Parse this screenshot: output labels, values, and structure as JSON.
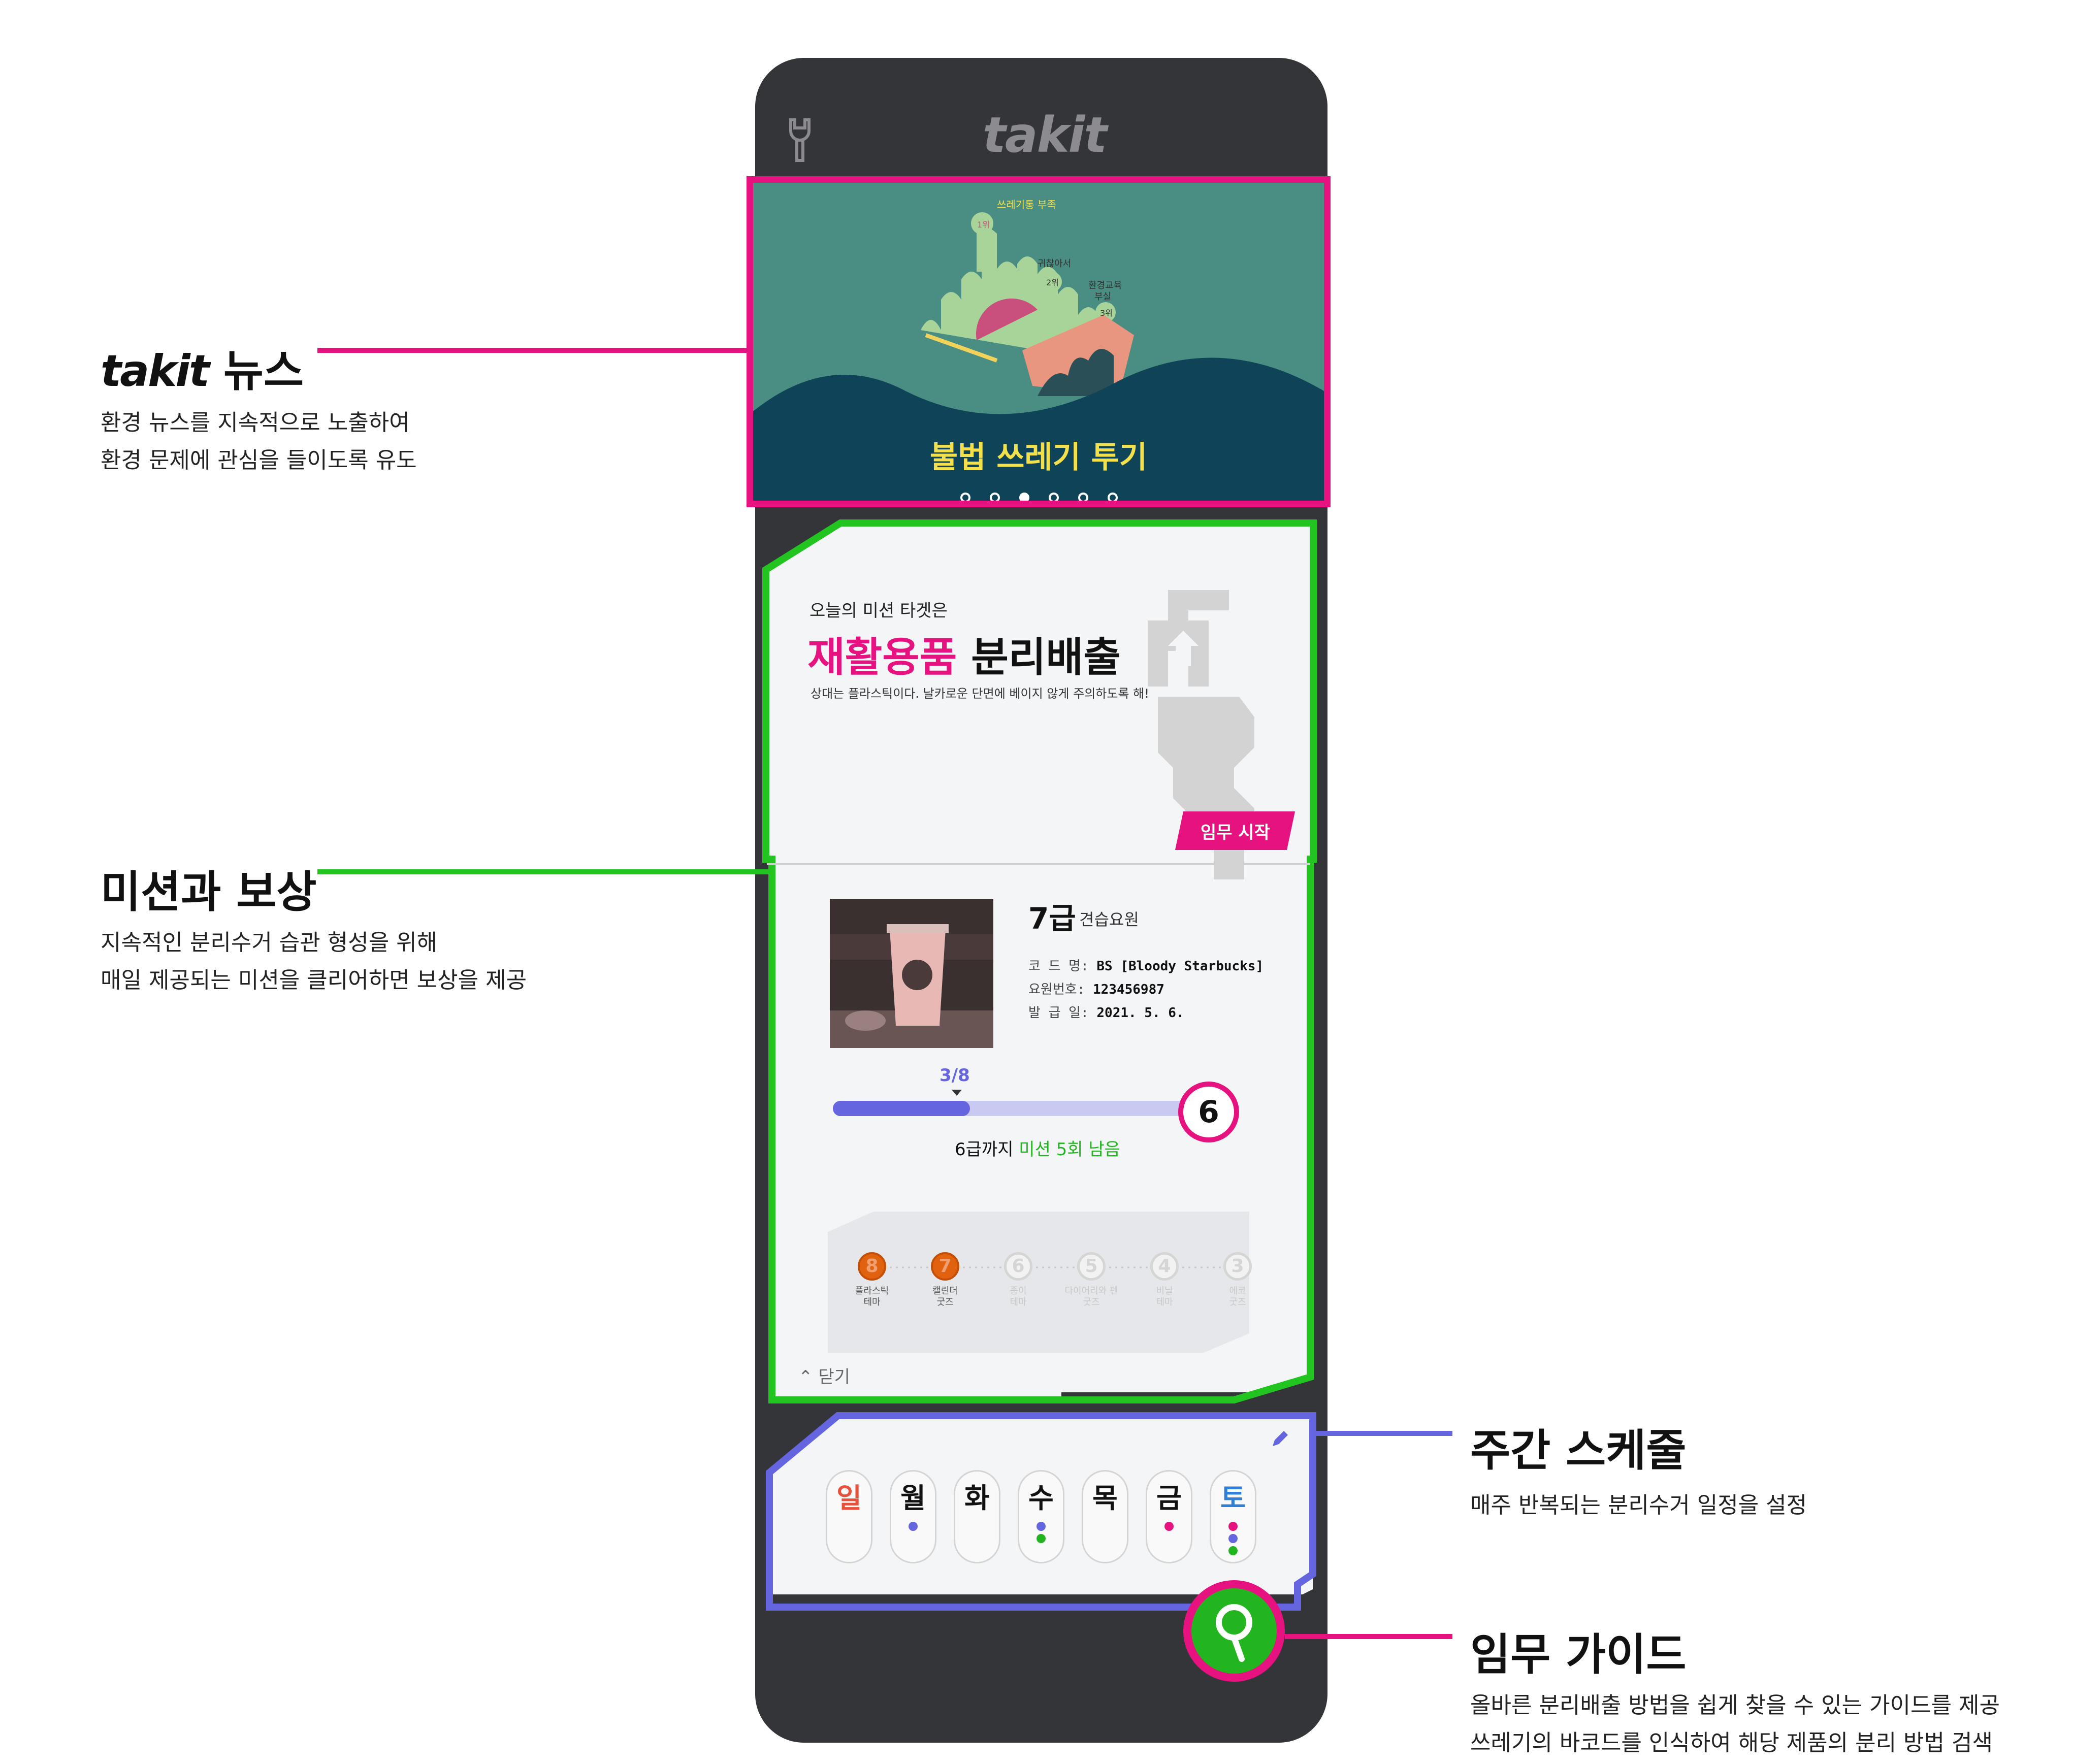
{
  "app": {
    "logo": "takit"
  },
  "news": {
    "infographic_labels": [
      "쓰레기통 부족",
      "1위",
      "귀찮아서",
      "2위",
      "환경교육",
      "부실",
      "3위"
    ],
    "title": "불법 쓰레기 투기",
    "slides": 6,
    "active_slide": 3
  },
  "mission": {
    "intro": "오늘의 미션 타겟은",
    "title_highlight": "재활용품",
    "title_rest": "분리배출",
    "description": "상대는 플라스틱이다. 날카로운 단면에 베이지 않게 주의하도록 해!",
    "start_button": "임무 시작"
  },
  "profile": {
    "grade": "7급",
    "rank": "견습요원",
    "code_label": "코 드 명:",
    "code_value": "BS [Bloody Starbucks]",
    "id_label": "요원번호:",
    "id_value": "123456987",
    "date_label": "발 급 일:",
    "date_value": "2021. 5. 6.",
    "progress_text": "3/8",
    "progress_fraction": 0.375,
    "next_grade": "6",
    "remain_prefix": "6급까지",
    "remain_highlight": "미션 5회 남음"
  },
  "steps": [
    {
      "num": "8",
      "label1": "플라스틱",
      "label2": "테마",
      "done": true
    },
    {
      "num": "7",
      "label1": "캘린더",
      "label2": "굿즈",
      "done": true
    },
    {
      "num": "6",
      "label1": "종이",
      "label2": "테마",
      "done": false
    },
    {
      "num": "5",
      "label1": "다이어리와 펜",
      "label2": "굿즈",
      "done": false
    },
    {
      "num": "4",
      "label1": "비닐",
      "label2": "테마",
      "done": false
    },
    {
      "num": "3",
      "label1": "에코",
      "label2": "굿즈",
      "done": false
    }
  ],
  "close_label": "닫기",
  "schedule": {
    "days": [
      {
        "label": "일",
        "color": "#e8503a",
        "dots": []
      },
      {
        "label": "월",
        "color": "#111111",
        "dots": [
          "#6565e0"
        ]
      },
      {
        "label": "화",
        "color": "#111111",
        "dots": []
      },
      {
        "label": "수",
        "color": "#111111",
        "dots": [
          "#6565e0",
          "#22b51f"
        ]
      },
      {
        "label": "목",
        "color": "#111111",
        "dots": []
      },
      {
        "label": "금",
        "color": "#111111",
        "dots": [
          "#e6127f"
        ]
      },
      {
        "label": "토",
        "color": "#2f7fd6",
        "dots": [
          "#e6127f",
          "#6565e0",
          "#22b51f"
        ]
      }
    ]
  },
  "annotations": {
    "news": {
      "brand": "takit",
      "title": "뉴스",
      "desc1": "환경 뉴스를 지속적으로 노출하여",
      "desc2": "환경 문제에 관심을 들이도록 유도"
    },
    "mission": {
      "title": "미션과 보상",
      "desc1": "지속적인 분리수거 습관 형성을 위해",
      "desc2": "매일 제공되는 미션을 클리어하면 보상을 제공"
    },
    "schedule": {
      "title": "주간 스케줄",
      "desc1": "매주 반복되는 분리수거 일정을 설정"
    },
    "guide": {
      "title": "임무 가이드",
      "desc1": "올바른 분리배출 방법을 쉽게 찾을 수 있는 가이드를 제공",
      "desc2": "쓰레기의 바코드를 인식하여 해당 제품의 분리 방법 검색"
    }
  },
  "colors": {
    "pink": "#e6127f",
    "green": "#22b51f",
    "purple": "#6565e0",
    "phone": "#333539"
  }
}
